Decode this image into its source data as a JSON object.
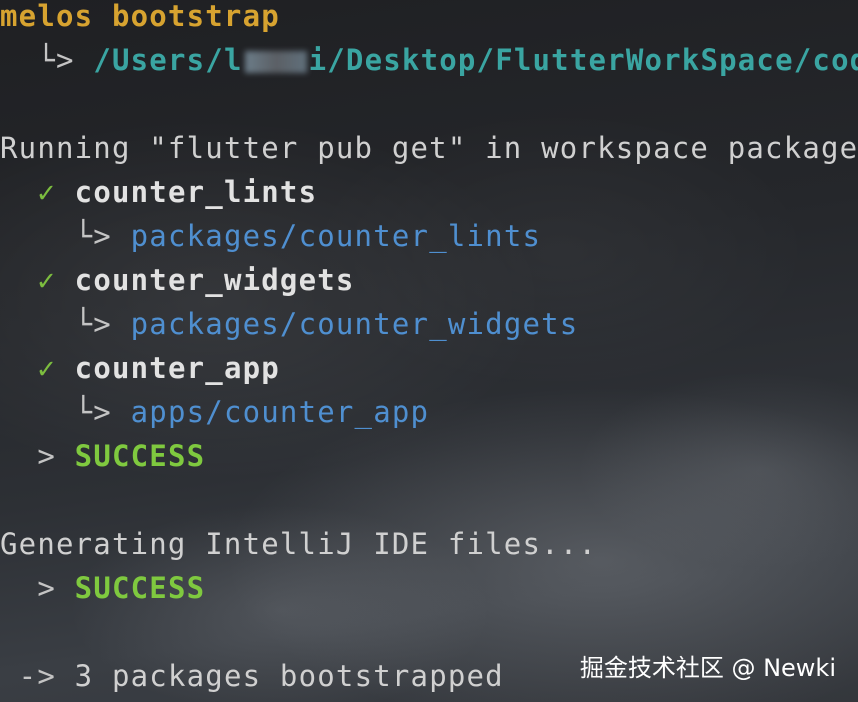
{
  "command": "melos bootstrap",
  "cwd": {
    "arrow": "└>",
    "path_prefix": "/Users/l",
    "path_suffix": "i/Desktop/FlutterWorkSpace/code"
  },
  "pub_get": {
    "message": "Running \"flutter pub get\" in workspace packages...",
    "packages": [
      {
        "check": "✓",
        "name": "counter_lints",
        "arrow": "└>",
        "path": "packages/counter_lints"
      },
      {
        "check": "✓",
        "name": "counter_widgets",
        "arrow": "└>",
        "path": "packages/counter_widgets"
      },
      {
        "check": "✓",
        "name": "counter_app",
        "arrow": "└>",
        "path": "apps/counter_app"
      }
    ],
    "result_prefix": ">",
    "result": "SUCCESS"
  },
  "ide": {
    "message": "Generating IntelliJ IDE files...",
    "result_prefix": ">",
    "result": "SUCCESS"
  },
  "summary": {
    "arrow": "->",
    "text": "3 packages bootstrapped"
  },
  "watermark": "掘金技术社区 @ Newki",
  "colors": {
    "command": "#d7a330",
    "cwd": "#3aa5a2",
    "path": "#4f8fd0",
    "success": "#7fc93f",
    "check": "#7cbd3f"
  }
}
